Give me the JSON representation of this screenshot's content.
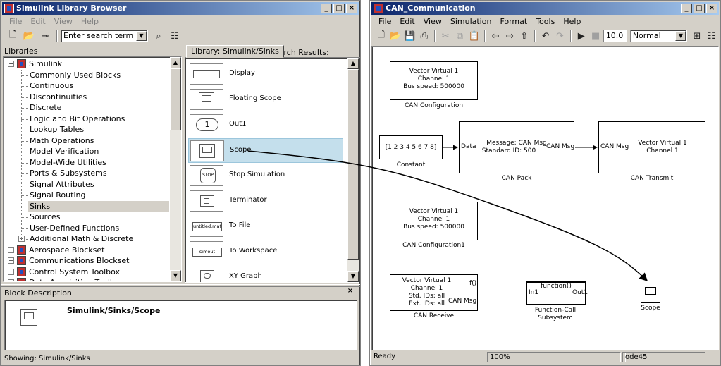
{
  "library_browser": {
    "title": "Simulink Library Browser",
    "menu": [
      "File",
      "Edit",
      "View",
      "Help"
    ],
    "search_placeholder": "Enter search term",
    "libraries_label": "Libraries",
    "tree": [
      {
        "label": "Simulink",
        "level": 0,
        "expanded": true
      },
      {
        "label": "Commonly Used Blocks",
        "level": 1
      },
      {
        "label": "Continuous",
        "level": 1
      },
      {
        "label": "Discontinuities",
        "level": 1
      },
      {
        "label": "Discrete",
        "level": 1
      },
      {
        "label": "Logic and Bit Operations",
        "level": 1
      },
      {
        "label": "Lookup Tables",
        "level": 1
      },
      {
        "label": "Math Operations",
        "level": 1
      },
      {
        "label": "Model Verification",
        "level": 1
      },
      {
        "label": "Model-Wide Utilities",
        "level": 1
      },
      {
        "label": "Ports & Subsystems",
        "level": 1
      },
      {
        "label": "Signal Attributes",
        "level": 1
      },
      {
        "label": "Signal Routing",
        "level": 1
      },
      {
        "label": "Sinks",
        "level": 1,
        "selected": true
      },
      {
        "label": "Sources",
        "level": 1
      },
      {
        "label": "User-Defined Functions",
        "level": 1
      },
      {
        "label": "Additional Math & Discrete",
        "level": 1,
        "collapsed": true
      },
      {
        "label": "Aerospace Blockset",
        "level": 0,
        "collapsed": true
      },
      {
        "label": "Communications Blockset",
        "level": 0,
        "collapsed": true
      },
      {
        "label": "Control System Toolbox",
        "level": 0,
        "collapsed": true
      },
      {
        "label": "Data Acquisition Toolbox",
        "level": 0,
        "collapsed": true
      }
    ],
    "tabs": [
      "Library: Simulink/Sinks",
      "Search Results: (none)"
    ],
    "blocks": [
      {
        "name": "Display",
        "icon_text": ""
      },
      {
        "name": "Floating Scope",
        "icon_text": ""
      },
      {
        "name": "Out1",
        "icon_text": "1"
      },
      {
        "name": "Scope",
        "icon_text": "",
        "selected": true
      },
      {
        "name": "Stop Simulation",
        "icon_text": "STOP"
      },
      {
        "name": "Terminator",
        "icon_text": ""
      },
      {
        "name": "To File",
        "icon_text": "untitled.mat"
      },
      {
        "name": "To Workspace",
        "icon_text": "simout"
      },
      {
        "name": "XY Graph",
        "icon_text": ""
      }
    ],
    "block_description_label": "Block Description",
    "block_description_path": "Simulink/Sinks/Scope",
    "status": "Showing: Simulink/Sinks"
  },
  "model_window": {
    "title": "CAN_Communication",
    "menu": [
      "File",
      "Edit",
      "View",
      "Simulation",
      "Format",
      "Tools",
      "Help"
    ],
    "stop_time": "10.0",
    "mode": "Normal",
    "blocks": {
      "can_config": {
        "lines": [
          "Vector Virtual 1",
          "Channel 1",
          "Bus speed: 500000"
        ],
        "label": "CAN Configuration"
      },
      "constant": {
        "value": "[1 2 3 4 5 6 7 8]",
        "label": "Constant"
      },
      "can_pack": {
        "lines": [
          "Message: CAN Msg",
          "Standard ID: 500"
        ],
        "in_port": "Data",
        "out_port": "CAN Msg",
        "label": "CAN Pack"
      },
      "can_transmit": {
        "lines": [
          "Vector Virtual 1",
          "Channel 1"
        ],
        "in_port": "CAN Msg",
        "label": "CAN Transmit"
      },
      "can_config1": {
        "lines": [
          "Vector Virtual 1",
          "Channel 1",
          "Bus speed: 500000"
        ],
        "label": "CAN Configuration1"
      },
      "can_receive": {
        "lines": [
          "Vector Virtual 1",
          "Channel 1",
          "Std. IDs: all",
          "Ext. IDs: all"
        ],
        "out_f": "f()",
        "out_msg": "CAN Msg",
        "label": "CAN Receive"
      },
      "fcs": {
        "top": "function()",
        "in_port": "In1",
        "out_port": "Out1",
        "label": "Function-Call",
        "label2": "Subsystem"
      },
      "scope": {
        "label": "Scope"
      }
    },
    "status": {
      "state": "Ready",
      "zoom": "100%",
      "solver": "ode45"
    }
  }
}
